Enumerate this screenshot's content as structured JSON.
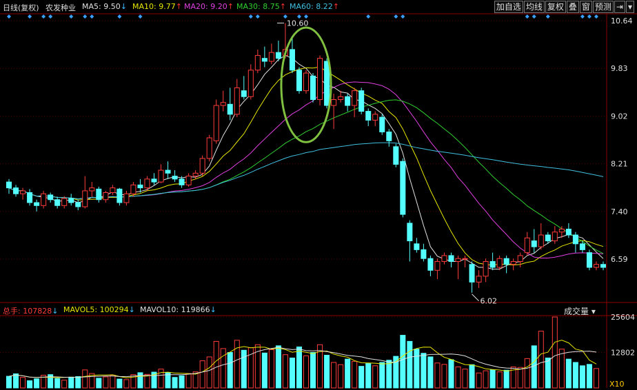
{
  "header": {
    "period": "日线(复权)",
    "stock_name": "农发种业",
    "ma": [
      {
        "label": "MA5:",
        "value": "9.50",
        "arrow": "down",
        "color": "#e0e0e0"
      },
      {
        "label": "MA10:",
        "value": "9.77",
        "arrow": "up",
        "color": "#e6e600"
      },
      {
        "label": "MA20:",
        "value": "9.20",
        "arrow": "up",
        "color": "#e040e0"
      },
      {
        "label": "MA30:",
        "value": "8.75",
        "arrow": "up",
        "color": "#30d030"
      },
      {
        "label": "MA60:",
        "value": "8.22",
        "arrow": "up",
        "color": "#40c0e0"
      }
    ],
    "buttons": [
      "加自选",
      "均线",
      "复权",
      "叠",
      "窗",
      "预测"
    ],
    "arrow_up_color": "#ff3030",
    "arrow_down_color": "#40c0ff"
  },
  "volume_bar": {
    "total_label": "总手:",
    "total_value": "107828",
    "mavol5_label": "MAVOL5:",
    "mavol5_value": "100294",
    "mavol10_label": "MAVOL10:",
    "mavol10_value": "119866",
    "indicator_select": "成交量"
  },
  "chart_data": {
    "type": "candlestick",
    "price_axis_ticks": [
      "10.64",
      "9.83",
      "9.02",
      "8.21",
      "7.40",
      "6.59"
    ],
    "volume_axis_ticks": [
      "25604",
      "12802",
      "X10"
    ],
    "price_range": [
      5.9,
      10.64
    ],
    "annotations": [
      {
        "text": "10.60",
        "type": "high_marker"
      },
      {
        "text": "6.02",
        "type": "low_marker"
      }
    ],
    "colors": {
      "up": "#ff3c3c",
      "down": "#54ffff",
      "ma5": "#e0e0e0",
      "ma10": "#e6e600",
      "ma20": "#e040e0",
      "ma30": "#30d030",
      "ma60": "#40c0e0",
      "highlight": "#80c040"
    },
    "candles": [
      [
        7.9,
        7.8,
        7.95,
        7.7
      ],
      [
        7.8,
        7.7,
        7.85,
        7.65
      ],
      [
        7.7,
        7.75,
        7.8,
        7.6
      ],
      [
        7.72,
        7.55,
        7.78,
        7.5
      ],
      [
        7.55,
        7.5,
        7.6,
        7.4
      ],
      [
        7.5,
        7.7,
        7.75,
        7.45
      ],
      [
        7.68,
        7.6,
        7.72,
        7.55
      ],
      [
        7.6,
        7.5,
        7.65,
        7.45
      ],
      [
        7.5,
        7.62,
        7.66,
        7.45
      ],
      [
        7.62,
        7.55,
        7.7,
        7.5
      ],
      [
        7.55,
        7.48,
        7.6,
        7.42
      ],
      [
        7.48,
        7.75,
        8.0,
        7.45
      ],
      [
        7.75,
        7.8,
        7.9,
        7.65
      ],
      [
        7.78,
        7.6,
        7.82,
        7.55
      ],
      [
        7.6,
        7.72,
        7.75,
        7.55
      ],
      [
        7.72,
        7.8,
        7.85,
        7.68
      ],
      [
        7.78,
        7.55,
        7.8,
        7.5
      ],
      [
        7.55,
        7.7,
        7.75,
        7.5
      ],
      [
        7.7,
        7.85,
        7.9,
        7.65
      ],
      [
        7.85,
        7.8,
        7.95,
        7.72
      ],
      [
        7.8,
        7.95,
        8.0,
        7.75
      ],
      [
        7.95,
        7.9,
        8.05,
        7.85
      ],
      [
        7.9,
        8.1,
        8.2,
        7.88
      ],
      [
        8.1,
        8.05,
        8.25,
        7.95
      ],
      [
        8.0,
        7.95,
        8.1,
        7.9
      ],
      [
        7.95,
        7.85,
        8.0,
        7.8
      ],
      [
        7.85,
        8.0,
        8.05,
        7.82
      ],
      [
        8.0,
        8.05,
        8.1,
        7.95
      ],
      [
        8.05,
        8.3,
        8.35,
        8.0
      ],
      [
        8.3,
        8.65,
        8.7,
        8.25
      ],
      [
        8.6,
        9.2,
        9.3,
        8.55
      ],
      [
        9.2,
        9.25,
        9.45,
        9.1
      ],
      [
        9.22,
        9.05,
        9.5,
        8.95
      ],
      [
        9.05,
        9.5,
        9.65,
        9.0
      ],
      [
        9.45,
        9.35,
        9.7,
        9.3
      ],
      [
        9.35,
        9.8,
        9.9,
        9.3
      ],
      [
        9.8,
        10.05,
        10.15,
        9.75
      ],
      [
        10.0,
        9.95,
        10.2,
        9.85
      ],
      [
        9.95,
        10.1,
        10.25,
        9.9
      ],
      [
        10.1,
        10.0,
        10.3,
        9.95
      ],
      [
        10.05,
        10.15,
        10.6,
        10.0
      ],
      [
        10.15,
        9.8,
        10.35,
        9.75
      ],
      [
        9.8,
        9.45,
        9.85,
        9.4
      ],
      [
        9.45,
        9.75,
        9.8,
        9.4
      ],
      [
        9.7,
        9.3,
        9.75,
        9.25
      ],
      [
        9.3,
        10.0,
        10.05,
        9.2
      ],
      [
        9.95,
        9.2,
        10.0,
        9.15
      ],
      [
        9.2,
        9.3,
        9.4,
        8.8
      ],
      [
        9.3,
        9.35,
        9.45,
        9.25
      ],
      [
        9.35,
        9.2,
        9.4,
        9.1
      ],
      [
        9.2,
        9.45,
        9.5,
        9.0
      ],
      [
        9.45,
        9.1,
        9.5,
        9.05
      ],
      [
        9.1,
        8.95,
        9.15,
        8.85
      ],
      [
        8.95,
        9.05,
        9.1,
        8.85
      ],
      [
        9.0,
        8.75,
        9.05,
        8.7
      ],
      [
        8.75,
        8.6,
        8.8,
        8.5
      ],
      [
        8.5,
        8.2,
        8.55,
        8.15
      ],
      [
        8.25,
        7.35,
        8.3,
        7.3
      ],
      [
        7.2,
        6.9,
        7.25,
        6.55
      ],
      [
        6.85,
        6.75,
        6.95,
        6.7
      ],
      [
        6.75,
        6.6,
        6.85,
        6.55
      ],
      [
        6.6,
        6.4,
        6.65,
        6.3
      ],
      [
        6.4,
        6.55,
        6.6,
        6.25
      ],
      [
        6.55,
        6.65,
        6.7,
        6.5
      ],
      [
        6.65,
        6.55,
        6.7,
        6.45
      ],
      [
        6.55,
        6.6,
        6.65,
        6.25
      ],
      [
        6.6,
        6.6,
        6.65,
        6.45
      ],
      [
        6.5,
        6.2,
        6.55,
        6.02
      ],
      [
        6.2,
        6.3,
        6.4,
        6.1
      ],
      [
        6.3,
        6.55,
        6.6,
        6.2
      ],
      [
        6.55,
        6.45,
        6.7,
        6.4
      ],
      [
        6.45,
        6.6,
        6.65,
        6.4
      ],
      [
        6.6,
        6.5,
        6.65,
        6.35
      ],
      [
        6.5,
        6.55,
        6.6,
        6.4
      ],
      [
        6.55,
        6.65,
        6.7,
        6.45
      ],
      [
        6.7,
        6.95,
        7.05,
        6.65
      ],
      [
        6.9,
        6.8,
        7.1,
        6.7
      ],
      [
        6.8,
        7.0,
        7.2,
        6.75
      ],
      [
        7.0,
        6.9,
        7.05,
        6.85
      ],
      [
        6.9,
        7.05,
        7.15,
        6.85
      ],
      [
        7.05,
        7.1,
        7.15,
        6.95
      ],
      [
        7.1,
        7.0,
        7.2,
        6.95
      ],
      [
        7.0,
        6.85,
        7.05,
        6.7
      ],
      [
        6.85,
        6.75,
        6.9,
        6.7
      ],
      [
        6.7,
        6.45,
        6.75,
        6.4
      ],
      [
        6.45,
        6.5,
        6.55,
        6.4
      ],
      [
        6.5,
        6.45,
        6.55,
        6.4
      ]
    ],
    "volumes": [
      4200,
      5100,
      3800,
      2600,
      3300,
      4600,
      4800,
      3400,
      2800,
      3900,
      4100,
      6500,
      5200,
      3500,
      4000,
      4600,
      3200,
      3000,
      4800,
      5500,
      4900,
      5700,
      6800,
      5600,
      3800,
      4400,
      5200,
      5800,
      9800,
      11200,
      16800,
      14200,
      12800,
      17200,
      13600,
      14500,
      15600,
      12600,
      13800,
      15200,
      12000,
      10800,
      14800,
      11600,
      12800,
      15600,
      11800,
      9200,
      8400,
      10400,
      9600,
      7800,
      8800,
      8000,
      9200,
      10000,
      11400,
      19000,
      16800,
      14000,
      12500,
      11200,
      9000,
      8500,
      10200,
      7600,
      6800,
      8400,
      5400,
      6200,
      6500,
      5800,
      6400,
      7600,
      7400,
      10600,
      15200,
      20500,
      10800,
      25600,
      14000,
      10400,
      9200,
      8000,
      8500,
      7000
    ]
  }
}
